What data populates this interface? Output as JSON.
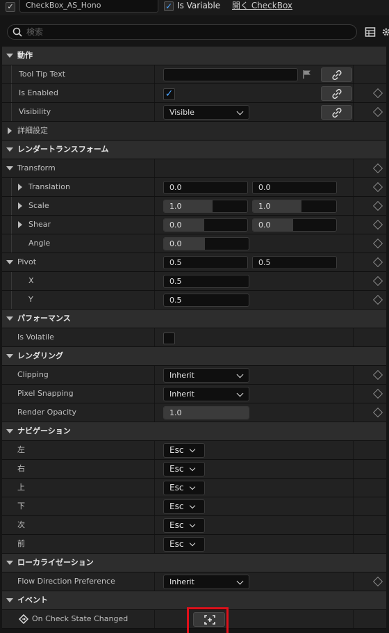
{
  "header": {
    "widget_name": "CheckBox_AS_Hono",
    "is_variable_label": "Is Variable",
    "is_variable_checked": true,
    "open_link": "開く CheckBox",
    "search_placeholder": "検索"
  },
  "sections": {
    "behavior": "動作",
    "advanced": "詳細設定",
    "render_transform": "レンダートランスフォーム",
    "performance": "パフォーマンス",
    "rendering": "レンダリング",
    "navigation": "ナビゲーション",
    "localization": "ローカライゼーション",
    "events": "イベント"
  },
  "behavior": {
    "tooltip_label": "Tool Tip Text",
    "tooltip_value": "",
    "enabled_label": "Is Enabled",
    "enabled_checked": true,
    "visibility_label": "Visibility",
    "visibility_value": "Visible"
  },
  "transform": {
    "label": "Transform",
    "translation_label": "Translation",
    "translation_x": "0.0",
    "translation_y": "0.0",
    "scale_label": "Scale",
    "scale_x": "1.0",
    "scale_y": "1.0",
    "shear_label": "Shear",
    "shear_x": "0.0",
    "shear_y": "0.0",
    "angle_label": "Angle",
    "angle_value": "0.0",
    "pivot_label": "Pivot",
    "pivot_x": "0.5",
    "pivot_y": "0.5",
    "pivot_x_label": "X",
    "pivot_x_value": "0.5",
    "pivot_y_label": "Y",
    "pivot_y_value": "0.5"
  },
  "performance": {
    "volatile_label": "Is Volatile",
    "volatile_checked": false
  },
  "rendering": {
    "clipping_label": "Clipping",
    "clipping_value": "Inherit",
    "pixel_snapping_label": "Pixel Snapping",
    "pixel_snapping_value": "Inherit",
    "render_opacity_label": "Render Opacity",
    "render_opacity_value": "1.0"
  },
  "navigation": {
    "items": [
      {
        "label": "左",
        "value": "Esc"
      },
      {
        "label": "右",
        "value": "Esc"
      },
      {
        "label": "上",
        "value": "Esc"
      },
      {
        "label": "下",
        "value": "Esc"
      },
      {
        "label": "次",
        "value": "Esc"
      },
      {
        "label": "前",
        "value": "Esc"
      }
    ]
  },
  "localization": {
    "flow_direction_label": "Flow Direction Preference",
    "flow_direction_value": "Inherit"
  },
  "events": {
    "on_check_state_changed_label": "On Check State Changed"
  },
  "colors": {
    "accent": "#4aa3ff",
    "highlight_frame": "#e0101a"
  }
}
